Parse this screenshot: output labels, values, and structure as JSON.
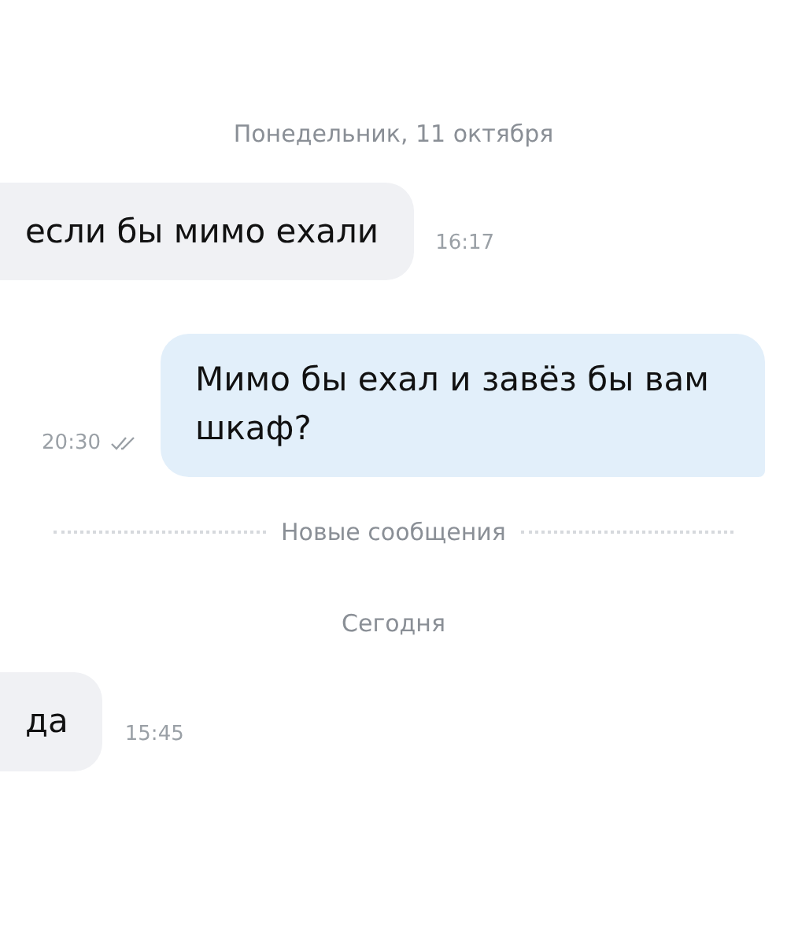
{
  "items": [
    {
      "kind": "date",
      "text": "Понедельник, 11 октября"
    },
    {
      "kind": "incoming",
      "text": "если бы мимо ехали",
      "time": "16:17"
    },
    {
      "kind": "outgoing",
      "text": "Мимо бы ехал и завёз бы вам шкаф?",
      "time": "20:30",
      "read": true
    },
    {
      "kind": "divider",
      "text": "Новые сообщения"
    },
    {
      "kind": "date",
      "text": "Сегодня"
    },
    {
      "kind": "incoming",
      "text": "да",
      "time": "15:45"
    }
  ]
}
